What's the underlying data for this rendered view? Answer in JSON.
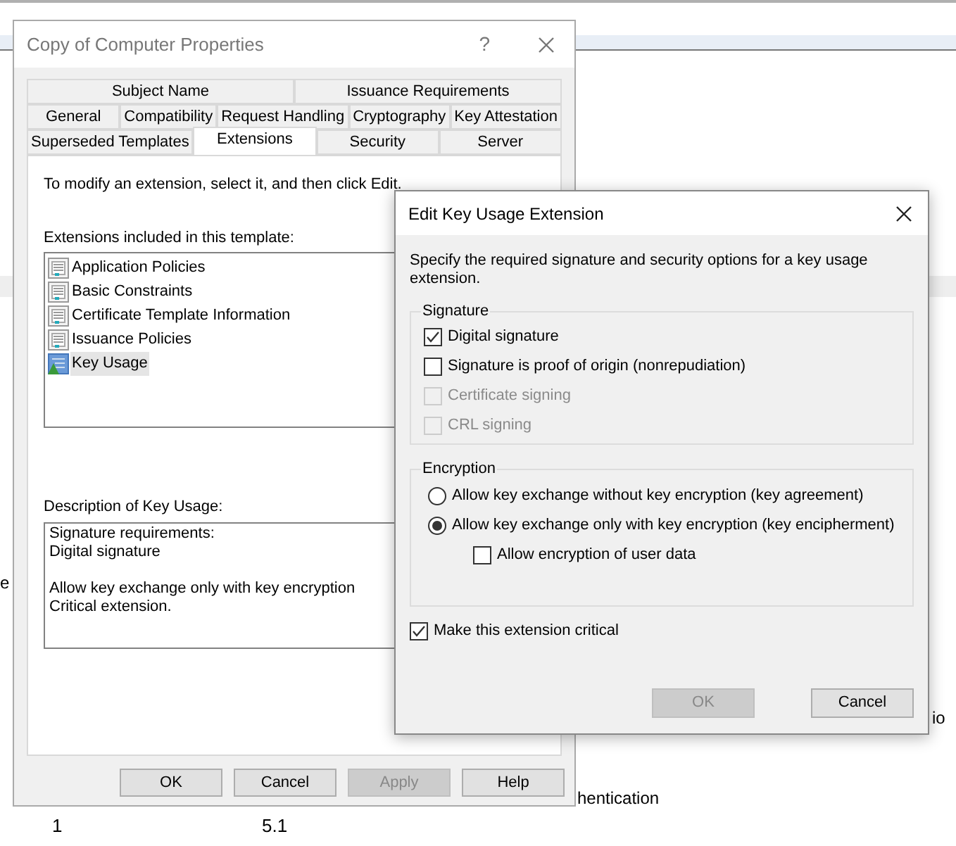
{
  "background": {
    "texts": [
      "e",
      "io",
      "hentication"
    ],
    "rows": [
      {
        "column_1": "1",
        "column_2": "5.1"
      }
    ]
  },
  "main_dialog": {
    "title": "Copy of Computer Properties",
    "help": "?",
    "tab_rows": [
      [
        {
          "label": "Subject Name",
          "selected": false
        },
        {
          "label": "Issuance Requirements",
          "selected": false
        }
      ],
      [
        {
          "label": "General",
          "selected": false
        },
        {
          "label": "Compatibility",
          "selected": false
        },
        {
          "label": "Request Handling",
          "selected": false
        },
        {
          "label": "Cryptography",
          "selected": false
        },
        {
          "label": "Key Attestation",
          "selected": false
        }
      ],
      [
        {
          "label": "Superseded Templates",
          "selected": false
        },
        {
          "label": "Extensions",
          "selected": true
        },
        {
          "label": "Security",
          "selected": false
        },
        {
          "label": "Server",
          "selected": false
        }
      ]
    ],
    "instruction": "To modify an extension, select it, and then click Edit.",
    "extensions_label": "Extensions included in this template:",
    "extensions": [
      {
        "label": "Application Policies",
        "critical": false,
        "selected": false
      },
      {
        "label": "Basic Constraints",
        "critical": false,
        "selected": false
      },
      {
        "label": "Certificate Template Information",
        "critical": false,
        "selected": false
      },
      {
        "label": "Issuance Policies",
        "critical": false,
        "selected": false
      },
      {
        "label": "Key Usage",
        "critical": true,
        "selected": true
      }
    ],
    "description_label": "Description of Key Usage:",
    "description": "Signature requirements:\nDigital signature\n\nAllow key exchange only with key encryption\nCritical extension.",
    "buttons": [
      {
        "label": "OK",
        "disabled": false
      },
      {
        "label": "Cancel",
        "disabled": false
      },
      {
        "label": "Apply",
        "disabled": true
      },
      {
        "label": "Help",
        "disabled": false
      }
    ]
  },
  "edit_dialog": {
    "title": "Edit Key Usage Extension",
    "description": "Specify the required signature and security options for a key usage extension.",
    "signature_group": {
      "title": "Signature",
      "options": [
        {
          "label": "Digital signature",
          "checked": true,
          "disabled": false
        },
        {
          "label": "Signature is proof of origin (nonrepudiation)",
          "checked": false,
          "disabled": false
        },
        {
          "label": "Certificate signing",
          "checked": false,
          "disabled": true
        },
        {
          "label": "CRL signing",
          "checked": false,
          "disabled": true
        }
      ]
    },
    "encryption_group": {
      "title": "Encryption",
      "options": [
        {
          "kind": "radio",
          "label": "Allow key exchange without key encryption (key agreement)",
          "selected": false
        },
        {
          "kind": "radio",
          "label": "Allow key exchange only with key encryption (key encipherment)",
          "selected": true,
          "children": [
            {
              "kind": "checkbox",
              "label": "Allow encryption of user data",
              "checked": false
            }
          ]
        }
      ]
    },
    "critical": {
      "label": "Make this extension critical",
      "checked": true
    },
    "buttons": [
      {
        "label": "OK",
        "disabled": true
      },
      {
        "label": "Cancel",
        "disabled": false
      }
    ]
  }
}
